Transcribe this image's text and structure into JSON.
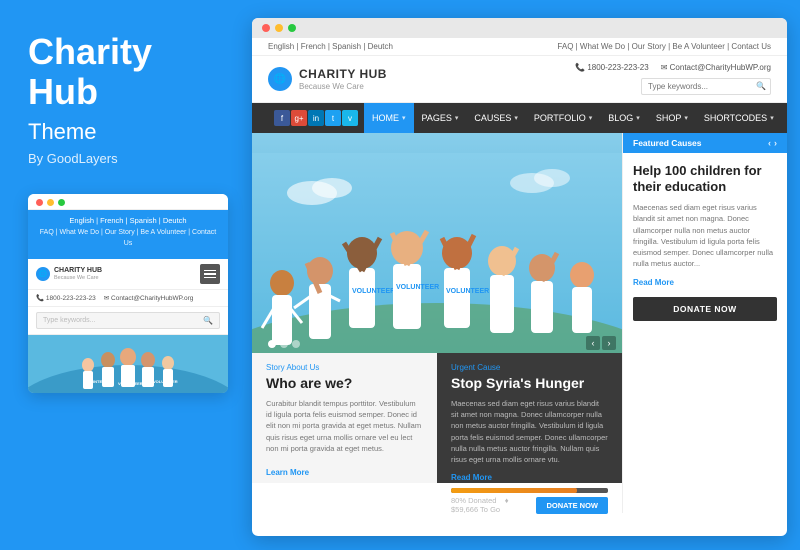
{
  "brand": {
    "title_line1": "Charity",
    "title_line2": "Hub",
    "subtitle": "Theme",
    "by": "By GoodLayers"
  },
  "mobile": {
    "dots": [
      "red",
      "yellow",
      "green"
    ],
    "top_nav": "English | French | Spanish | Deutch",
    "links": "FAQ | What We Do | Our Story | Be A Volunteer | Contact Us",
    "logo_text": "CHARITY HUB",
    "logo_tagline": "Because We Care",
    "phone": "📞 1800-223-223-23",
    "email": "✉ Contact@CharityHubWP.org",
    "search_placeholder": "Type keywords..."
  },
  "browser": {
    "dots": [
      "red",
      "yellow",
      "green"
    ],
    "top_bar_left": "English | French | Spanish | Deutch",
    "top_bar_right": "FAQ | What We Do | Our Story | Be A Volunteer | Contact Us",
    "phone": "📞 1800-223-223-23",
    "email": "✉ Contact@CharityHubWP.org",
    "logo_text": "CHARITY HUB",
    "logo_tagline": "Because We Care",
    "search_placeholder": "Type keywords...",
    "nav_items": [
      {
        "label": "HOME",
        "caret": true,
        "active": true
      },
      {
        "label": "PAGES",
        "caret": true,
        "active": false
      },
      {
        "label": "CAUSES",
        "caret": true,
        "active": false
      },
      {
        "label": "PORTFOLIO",
        "caret": true,
        "active": false
      },
      {
        "label": "BLOG",
        "caret": true,
        "active": false
      },
      {
        "label": "SHOP",
        "caret": true,
        "active": false
      },
      {
        "label": "SHORTCODES",
        "caret": true,
        "active": false
      }
    ],
    "social_icons": [
      "f",
      "g+",
      "in",
      "t",
      "v"
    ],
    "featured_causes_label": "Featured Causes",
    "fc_title": "Help 100 children for their education",
    "fc_body": "Maecenas sed diam eget risus varius blandit sit amet non magna. Donec ullamcorper nulla non metus auctor fringilla. Vestibulum id ligula porta felis euismod semper. Donec ullamcorper nulla nulla metus auctor...",
    "fc_read_more": "Read More",
    "fc_donate_btn": "DONATE NOW",
    "story_label": "Story About Us",
    "story_title": "Who are we?",
    "story_body": "Curabitur blandit tempus porttitor. Vestibulum id ligula porta felis euismod semper. Donec id elit non mi porta gravida at eget metus. Nullam quis risus eget urna mollis ornare vel eu lect non mi porta gravida at eget metus.",
    "story_read_more": "Learn More",
    "urgent_label": "Urgent Cause",
    "urgent_title": "Stop Syria's Hunger",
    "urgent_body": "Maecenas sed diam eget risus varius blandit sit amet non magna. Donec ullamcorper nulla non metus auctor fringilla. Vestibulum id ligula porta felis euismod semper. Donec ullamcorper nulla nulla metus auctor fringilla. Nullam quis risus eget urna mollis ornare vtu.",
    "urgent_read_more": "Read More",
    "progress_pct": 80,
    "progress_label": "80% Donated",
    "goal_label": "♦ $59,666 To Go",
    "urgent_donate_btn": "DONATE NOW"
  }
}
